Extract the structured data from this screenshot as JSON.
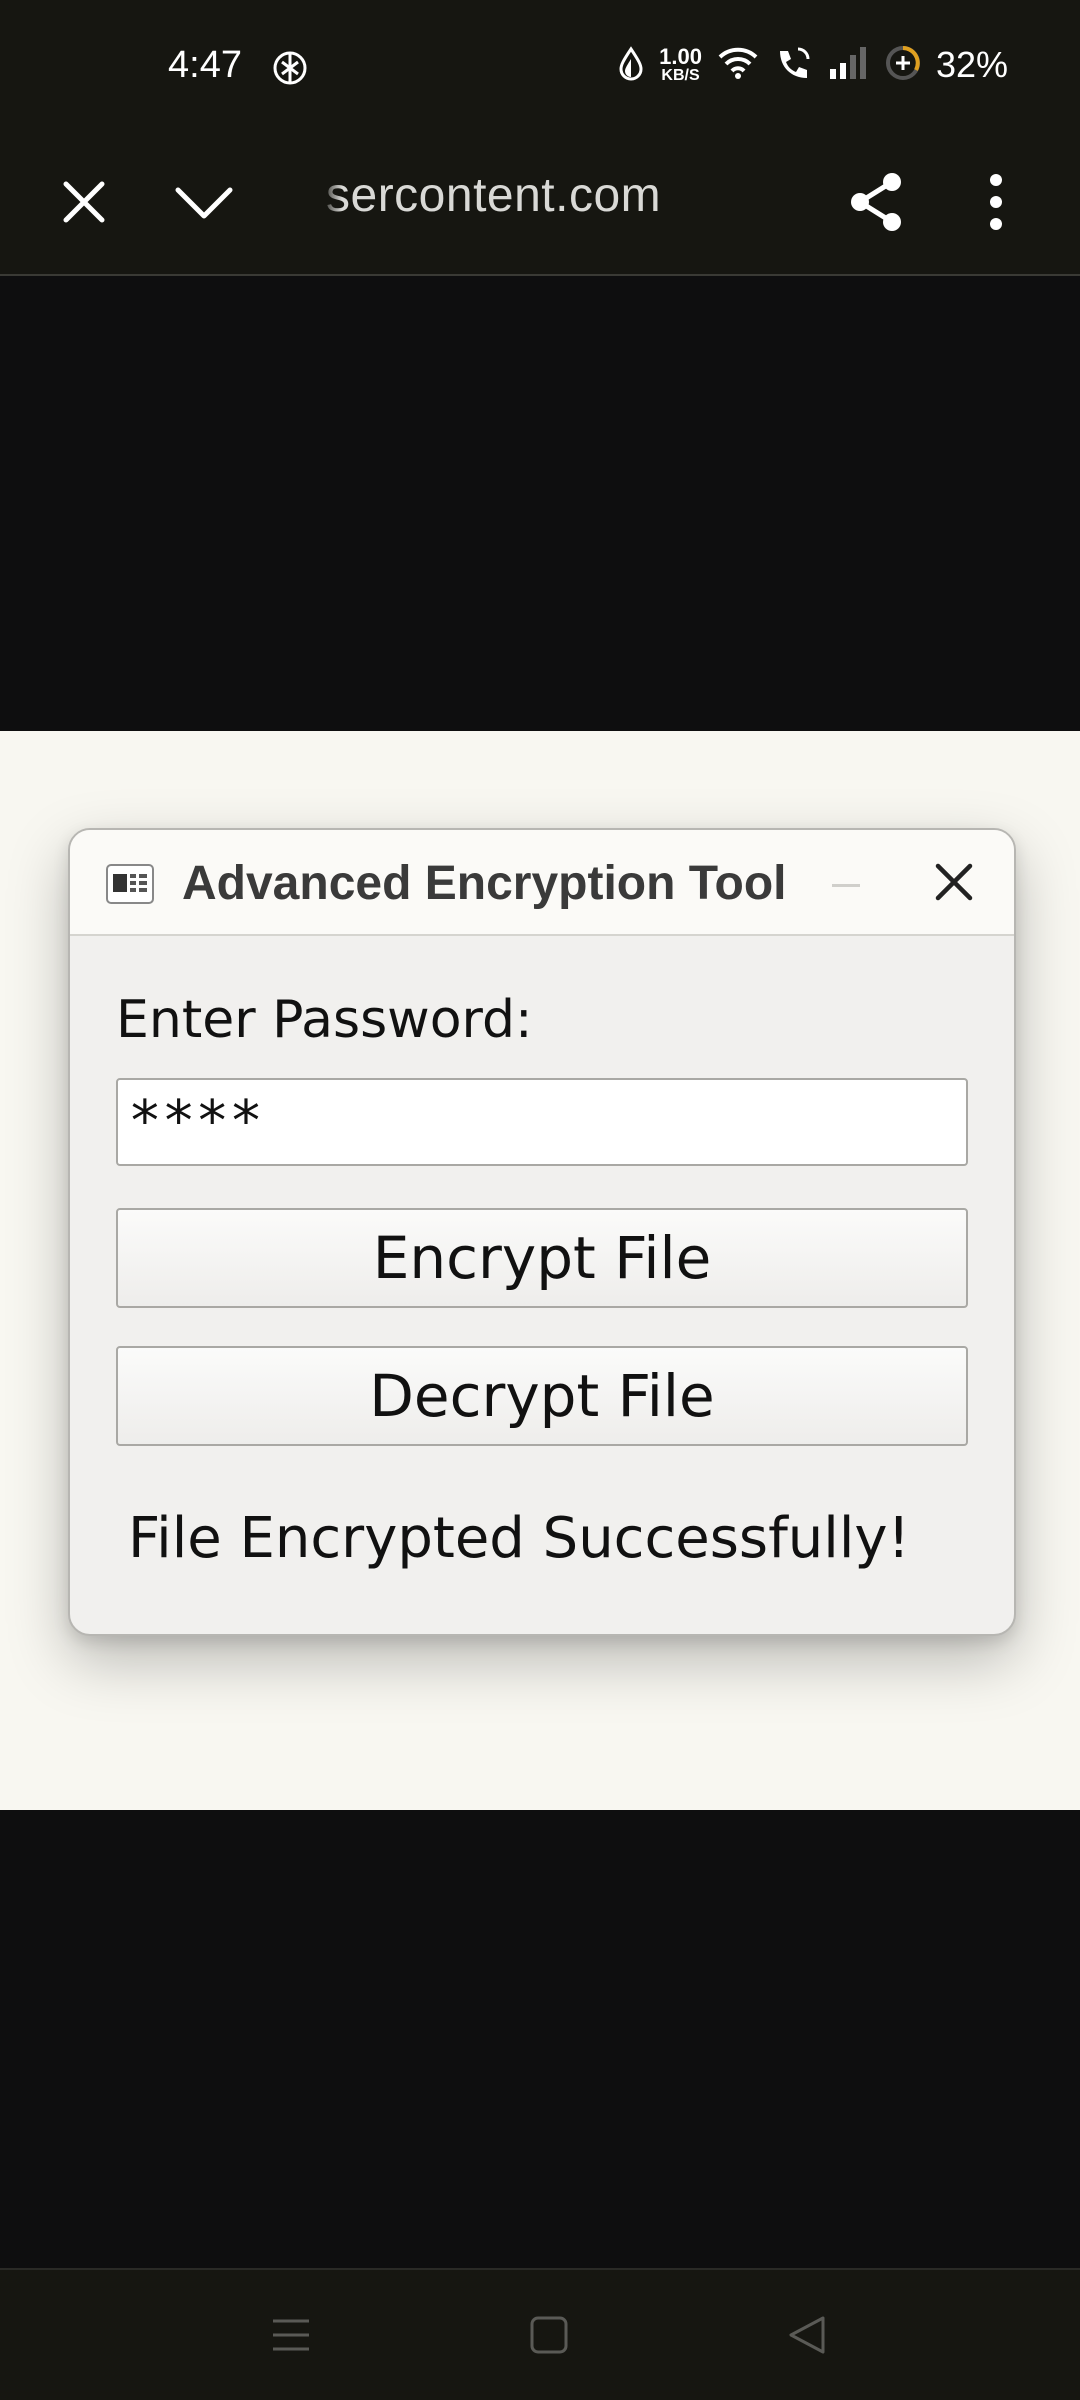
{
  "status_bar": {
    "time": "4:47",
    "net_speed_value": "1.00",
    "net_speed_unit": "KB/S",
    "battery": "32%",
    "icons": [
      "chatgpt-icon",
      "data-saver-icon",
      "wifi-icon",
      "wifi-call-icon",
      "signal-icon",
      "battery-saver-icon"
    ]
  },
  "browser": {
    "url": "sercontent.com",
    "icons": [
      "close-icon",
      "chevron-down-icon",
      "share-icon",
      "more-vert-icon"
    ]
  },
  "dialog": {
    "title": "Advanced Encryption Tool",
    "password_label": "Enter Password:",
    "password_value": "****",
    "encrypt_label": "Encrypt File",
    "decrypt_label": "Decrypt File",
    "status_message": "File Encrypted Successfully!"
  },
  "navbar": {
    "icons": [
      "menu-icon",
      "home-icon",
      "back-icon"
    ]
  },
  "colors": {
    "system_bar_bg": "#161611",
    "page_bg": "#0e0e0f",
    "canvas_bg": "#f8f7f1",
    "window_bg": "#f1f0ee"
  }
}
